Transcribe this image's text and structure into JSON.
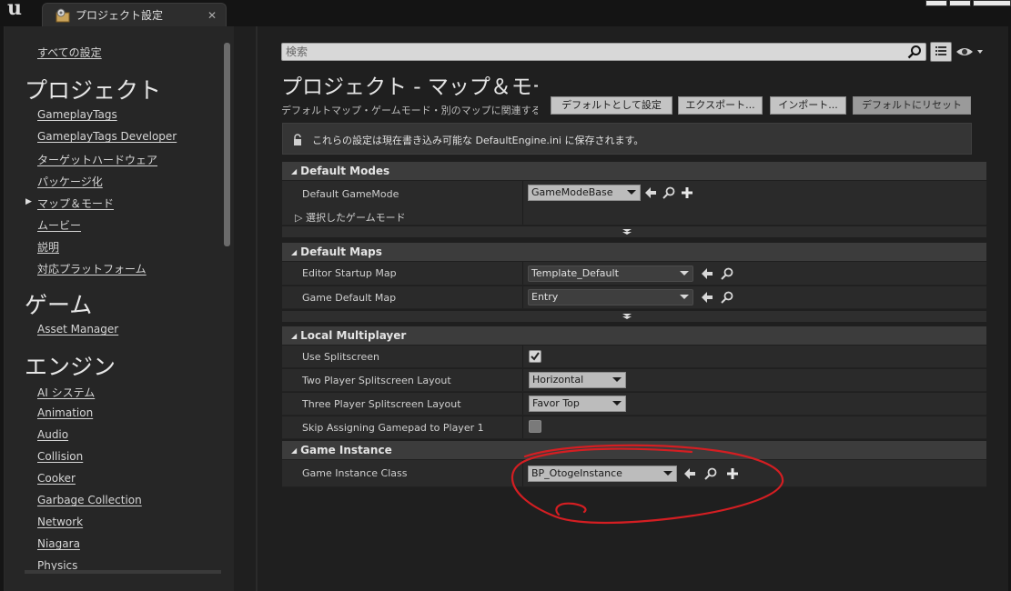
{
  "window": {
    "tab_title": "プロジェクト設定",
    "tab_close": "✕",
    "logo_text": "u"
  },
  "sidebar": {
    "all_settings": "すべての設定",
    "sections": [
      {
        "title": "プロジェクト",
        "items": [
          "GameplayTags",
          "GameplayTags Developer",
          "ターゲットハードウェア",
          "パッケージ化",
          "マップ＆モード",
          "ムービー",
          "説明",
          "対応プラットフォーム"
        ]
      },
      {
        "title": "ゲーム",
        "items": [
          "Asset Manager"
        ]
      },
      {
        "title": "エンジン",
        "items": [
          "AI システム",
          "Animation",
          "Audio",
          "Collision",
          "Cooker",
          "Garbage Collection",
          "Network",
          "Niagara",
          "Physics"
        ]
      }
    ],
    "selected_marker": "▶"
  },
  "search": {
    "placeholder": "検索"
  },
  "header": {
    "title": "プロジェクト - マップ＆モード",
    "description": "デフォルトマップ・ゲームモード・別のマップに関連するその他の設定",
    "buttons": {
      "set_default": "デフォルトとして設定",
      "export": "エクスポート...",
      "import": "インポート...",
      "reset": "デフォルトにリセット"
    }
  },
  "notice": {
    "text": "これらの設定は現在書き込み可能な DefaultEngine.ini に保存されます。"
  },
  "categories": {
    "default_modes": {
      "title": "Default Modes",
      "game_mode_label": "Default GameMode",
      "game_mode_value": "GameModeBase",
      "selected_game_mode_label": "選択したゲームモード"
    },
    "default_maps": {
      "title": "Default Maps",
      "editor_startup_label": "Editor Startup Map",
      "editor_startup_value": "Template_Default",
      "game_default_label": "Game Default Map",
      "game_default_value": "Entry"
    },
    "local_multiplayer": {
      "title": "Local Multiplayer",
      "use_splitscreen_label": "Use Splitscreen",
      "use_splitscreen_checked": true,
      "two_player_label": "Two Player Splitscreen Layout",
      "two_player_value": "Horizontal",
      "three_player_label": "Three Player Splitscreen Layout",
      "three_player_value": "Favor Top",
      "skip_gamepad_label": "Skip Assigning Gamepad to Player 1",
      "skip_gamepad_checked": false
    },
    "game_instance": {
      "title": "Game Instance",
      "class_label": "Game Instance Class",
      "class_value": "BP_OtogeInstance"
    }
  },
  "colors": {
    "annotation": "#d41e22",
    "background": "#1f1f1f",
    "panel": "#2a2a2a",
    "category_header": "#3c3c3c"
  },
  "icons": {
    "browse": "arrow-left-icon",
    "find": "magnifier-icon",
    "add": "plus-icon",
    "lock": "lock-icon",
    "visibility": "eye-icon"
  }
}
